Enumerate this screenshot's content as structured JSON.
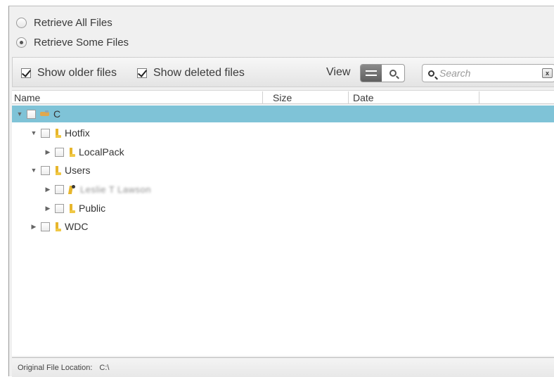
{
  "retrieve_options": [
    {
      "label": "Retrieve All Files",
      "selected": false
    },
    {
      "label": "Retrieve Some Files",
      "selected": true
    }
  ],
  "toolbar": {
    "show_older_label": "Show older files",
    "show_older_checked": true,
    "show_deleted_label": "Show deleted files",
    "show_deleted_checked": true,
    "view_label": "View",
    "search_placeholder": "Search",
    "clear_label": "x"
  },
  "columns": [
    "Name",
    "Size",
    "Date"
  ],
  "tree": [
    {
      "label": "C",
      "icon": "drive-icon",
      "expanded": true,
      "selected": true
    },
    {
      "label": "Hotfix",
      "icon": "folder-icon",
      "expanded": true
    },
    {
      "label": "LocalPack",
      "icon": "folder-icon",
      "expanded": false
    },
    {
      "label": "Users",
      "icon": "folder-icon",
      "expanded": true
    },
    {
      "label": "Leslie T Lawson",
      "icon": "user-folder-icon",
      "expanded": false,
      "blurred": true
    },
    {
      "label": "Public",
      "icon": "folder-icon",
      "expanded": false
    },
    {
      "label": "WDC",
      "icon": "folder-icon",
      "expanded": false
    }
  ],
  "status": {
    "label": "Original File Location:",
    "value": "C:\\"
  },
  "colors": {
    "selected_row": "#7fc3d7",
    "folder": "#e7b62c"
  }
}
